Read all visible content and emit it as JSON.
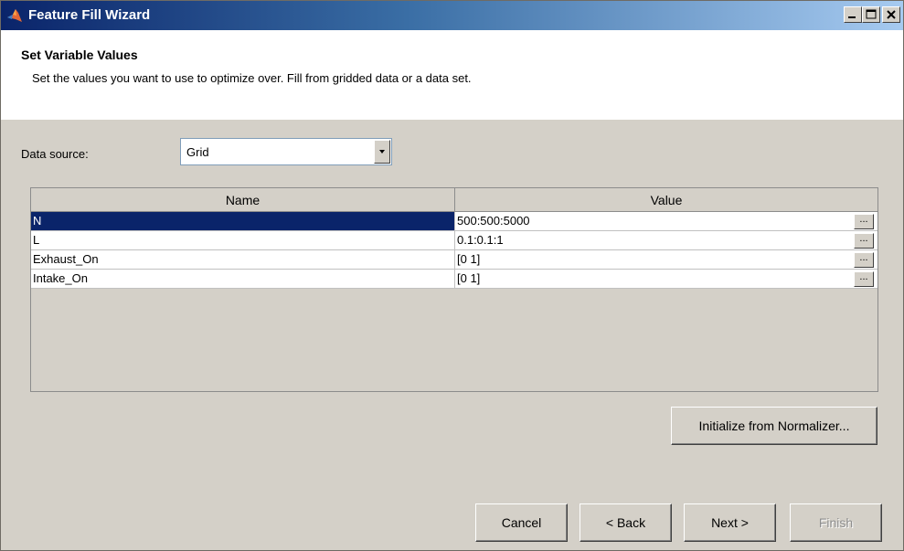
{
  "window": {
    "title": "Feature Fill Wizard"
  },
  "header": {
    "title": "Set Variable Values",
    "description": "Set the values you want to use to optimize over. Fill from gridded data or a data set."
  },
  "data_source": {
    "label": "Data source:",
    "selected": "Grid"
  },
  "table": {
    "columns": [
      "Name",
      "Value"
    ],
    "rows": [
      {
        "name": "N",
        "value": "500:500:5000",
        "button": "..."
      },
      {
        "name": "L",
        "value": "0.1:0.1:1",
        "button": "..."
      },
      {
        "name": "Exhaust_On",
        "value": "[0 1]",
        "button": "..."
      },
      {
        "name": "Intake_On",
        "value": "[0 1]",
        "button": "..."
      }
    ]
  },
  "buttons": {
    "initialize": "Initialize from Normalizer...",
    "cancel": "Cancel",
    "back": "< Back",
    "next": "Next >",
    "finish": "Finish"
  },
  "colors": {
    "selection": "#0a246a",
    "title_bar": "#0a246a"
  }
}
